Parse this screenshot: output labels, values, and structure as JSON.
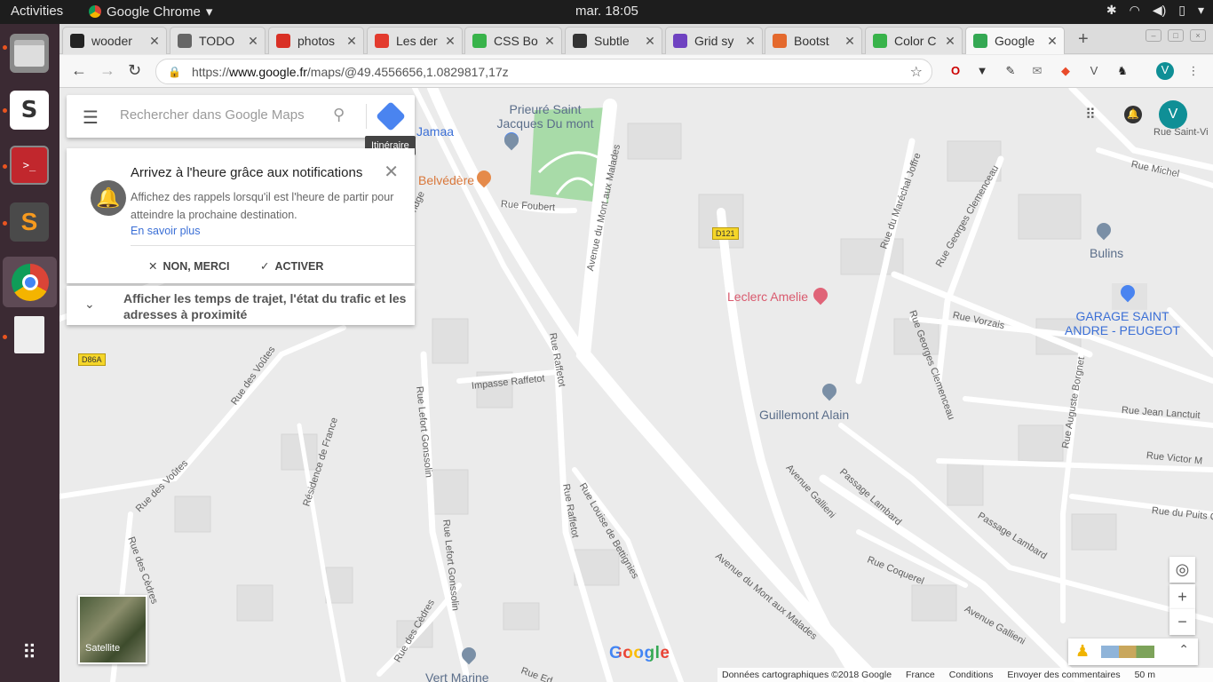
{
  "system": {
    "activities": "Activities",
    "app_name": "Google Chrome",
    "clock": "mar. 18:05"
  },
  "browser": {
    "tabs": [
      {
        "title": "wooder",
        "favicon_color": "#222"
      },
      {
        "title": "TODO",
        "favicon_color": "#666"
      },
      {
        "title": "photos",
        "favicon_color": "#d93025"
      },
      {
        "title": "Les der",
        "favicon_color": "#e33b2e"
      },
      {
        "title": "CSS Bo",
        "favicon_color": "#38b34a"
      },
      {
        "title": "Subtle",
        "favicon_color": "#333"
      },
      {
        "title": "Grid sy",
        "favicon_color": "#6f42c1"
      },
      {
        "title": "Bootst",
        "favicon_color": "#e4692d"
      },
      {
        "title": "Color C",
        "favicon_color": "#38b34a"
      },
      {
        "title": "Google",
        "favicon_color": "#34a853",
        "active": true
      }
    ],
    "url_prefix": "https://",
    "url_domain": "www.google.fr",
    "url_path": "/maps/@49.4556656,1.0829817,17z"
  },
  "maps": {
    "search_placeholder": "Rechercher dans Google Maps",
    "directions_tooltip": "Itinéraire",
    "notification": {
      "title": "Arrivez à l'heure grâce aux notifications",
      "body": "Affichez des rappels lorsqu'il est l'heure de partir pour atteindre la prochaine destination.",
      "link": "En savoir plus",
      "decline": "NON, MERCI",
      "accept": "ACTIVER"
    },
    "traffic_prompt": "Afficher les temps de trajet, l'état du trafic et les adresses à proximité",
    "avatar_letter": "V",
    "satellite_label": "Satellite",
    "logo": "Google",
    "footer": {
      "data": "Données cartographiques ©2018 Google",
      "country": "France",
      "terms": "Conditions",
      "feedback": "Envoyer des commentaires",
      "scale": "50 m"
    },
    "places": {
      "prieure": "Prieuré Saint Jacques Du mont",
      "jamaa": "Jamaa",
      "belvedere": "Belvédère",
      "leclerc": "Leclerc Amelie",
      "bulins": "Bulins",
      "garage": "GARAGE SAINT ANDRE - PEUGEOT",
      "guillemont": "Guillemont Alain",
      "vert_marine": "Vert Marine"
    },
    "road_badges": {
      "d121": "D121",
      "d86a": "D86A"
    },
    "streets": {
      "foubert": "Rue Foubert",
      "mont_malades": "Avenue du Mont aux Malades",
      "mont_malades_2": "Avenue du Mont aux Malades",
      "raffetot": "Rue Raffetot",
      "raffetot_2": "Rue Raffetot",
      "impasse": "Impasse Raffetot",
      "voutes": "Rue des Voûtes",
      "voutes_2": "Rue des Voûtes",
      "lefort": "Rue Lefort Gonssolin",
      "lefort_2": "Rue Lefort Gonssolin",
      "residence": "Résidence de France",
      "bettignies": "Rue Louise de Bettignies",
      "cedres": "Rue des Cèdres",
      "cedres_2": "Rue des Cèdres",
      "gallieni": "Avenue Gallieni",
      "gallieni_2": "Avenue Gallieni",
      "lambard": "Passage Lambard",
      "lambard_2": "Passage Lambard",
      "coquerel": "Rue Coquerel",
      "joffre": "Rue du Maréchal Joffre",
      "clemenceau": "Rue Georges Clemenceau",
      "clemenceau_2": "Rue Georges Clemenceau",
      "vorzais": "Rue Vorzais",
      "michel": "Rue Michel",
      "saint_vi": "Rue Saint-Vi",
      "borgnet": "Rue Auguste Borgnet",
      "lanctuit": "Rue Jean Lanctuit",
      "victor": "Rue Victor M",
      "puits": "Rue du Puits C",
      "bridge": "Bridge",
      "ru_ed": "Rue Ed"
    }
  }
}
